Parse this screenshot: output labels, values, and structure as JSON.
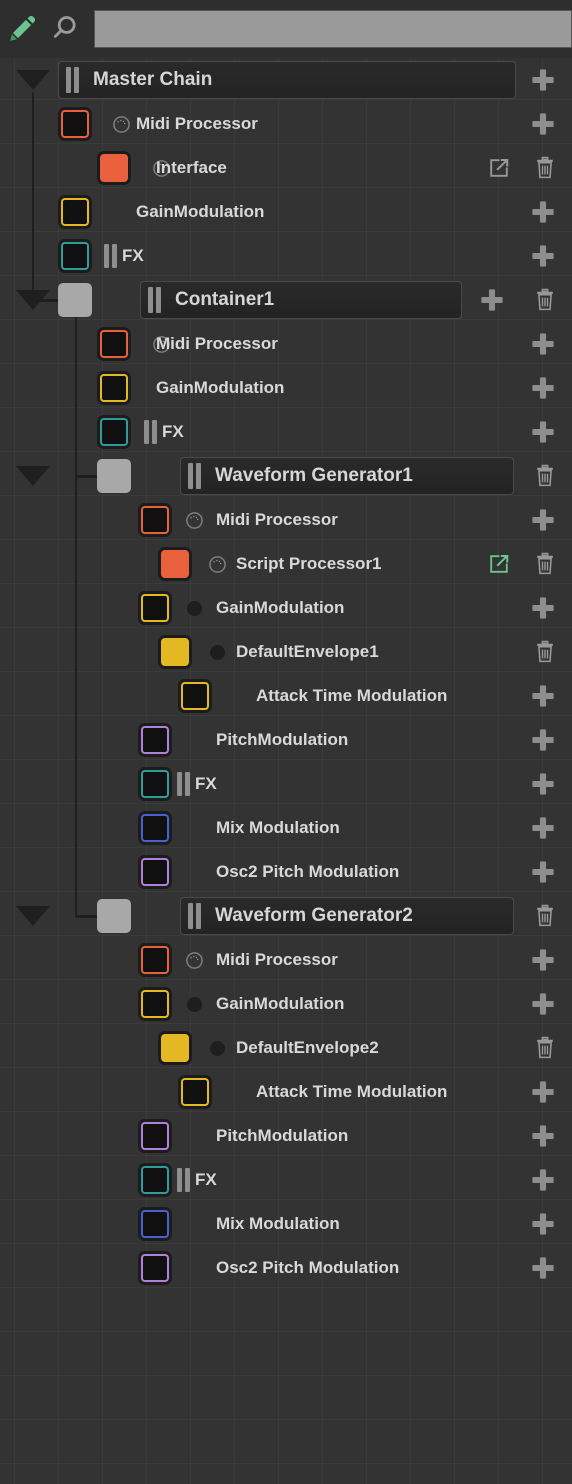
{
  "toolbar": {
    "pencil_icon": "pencil-icon",
    "search_icon": "search-icon",
    "search_value": "",
    "search_placeholder": "",
    "pencil_color": "#6cc48f"
  },
  "colors": {
    "background": "#333333",
    "toolbar_background": "#2e2e2e",
    "text": "#d9d9d9",
    "midi_processor": "#e8603c",
    "gain_modulation": "#e3b822",
    "fx": "#2f9b9b",
    "pitch_modulation": "#b07fe0",
    "mix_modulation": "#4a5fd0",
    "container": "#a8a8a8",
    "accent_green": "#6cc48f",
    "icon_gray": "#8e8e8e",
    "connector": "#1f1f1f"
  },
  "icons": {
    "add": "plus-icon",
    "delete": "trash-icon",
    "popout": "external-link-icon",
    "collapse": "triangle-down-icon",
    "drag": "drag-handle-icon",
    "knob": "knob-icon",
    "bullet": "dot-icon"
  },
  "tree": {
    "rows": [
      {
        "id": "master-chain",
        "label": "Master Chain",
        "kind": "chain",
        "depth": 0,
        "toggle": true,
        "swatch": null,
        "icon": "drag",
        "actions": [
          "add"
        ]
      },
      {
        "id": "midi-processor-master",
        "label": "Midi Processor",
        "kind": "module",
        "depth": 1,
        "toggle": false,
        "swatch": "midi_processor",
        "swatch_style": "outline",
        "icon": "knob",
        "actions": [
          "add"
        ]
      },
      {
        "id": "interface",
        "label": "Interface",
        "kind": "module",
        "depth": 2,
        "toggle": false,
        "swatch": "midi_processor",
        "swatch_style": "solid",
        "icon": "knob",
        "actions": [
          "popout",
          "delete"
        ]
      },
      {
        "id": "gainmodulation-master",
        "label": "GainModulation",
        "kind": "module",
        "depth": 1,
        "toggle": false,
        "swatch": "gain_modulation",
        "swatch_style": "outline",
        "icon": "none",
        "actions": [
          "add"
        ]
      },
      {
        "id": "fx-master",
        "label": "FX",
        "kind": "module",
        "depth": 1,
        "toggle": false,
        "swatch": "fx",
        "swatch_style": "outline",
        "icon": "bars",
        "actions": [
          "add"
        ]
      },
      {
        "id": "container1",
        "label": "Container1",
        "kind": "container",
        "depth": 1,
        "toggle": true,
        "swatch": "container",
        "swatch_style": "plain",
        "icon": "drag",
        "actions": [
          "add",
          "delete"
        ]
      },
      {
        "id": "midi-processor-c1",
        "label": "Midi Processor",
        "kind": "module",
        "depth": 2,
        "toggle": false,
        "swatch": "midi_processor",
        "swatch_style": "outline",
        "icon": "knob",
        "actions": [
          "add"
        ]
      },
      {
        "id": "gainmodulation-c1",
        "label": "GainModulation",
        "kind": "module",
        "depth": 2,
        "toggle": false,
        "swatch": "gain_modulation",
        "swatch_style": "outline",
        "icon": "none",
        "actions": [
          "add"
        ]
      },
      {
        "id": "fx-c1",
        "label": "FX",
        "kind": "module",
        "depth": 2,
        "toggle": false,
        "swatch": "fx",
        "swatch_style": "outline",
        "icon": "bars",
        "actions": [
          "add"
        ]
      },
      {
        "id": "waveform-generator1",
        "label": "Waveform Generator1",
        "kind": "container",
        "depth": 2,
        "toggle": true,
        "swatch": "container",
        "swatch_style": "plain",
        "icon": "drag",
        "actions": [
          "delete"
        ]
      },
      {
        "id": "midi-processor-wg1",
        "label": "Midi Processor",
        "kind": "module",
        "depth": 3,
        "toggle": false,
        "swatch": "midi_processor",
        "swatch_style": "outline",
        "icon": "knob",
        "actions": [
          "add"
        ]
      },
      {
        "id": "script-processor1",
        "label": "Script Processor1",
        "kind": "module",
        "depth": 4,
        "toggle": false,
        "swatch": "midi_processor",
        "swatch_style": "solid",
        "icon": "knob",
        "actions": [
          "popout-green",
          "delete"
        ]
      },
      {
        "id": "gainmodulation-wg1",
        "label": "GainModulation",
        "kind": "module",
        "depth": 3,
        "toggle": false,
        "swatch": "gain_modulation",
        "swatch_style": "outline",
        "icon": "bullet",
        "actions": [
          "add"
        ]
      },
      {
        "id": "defaultenvelope1",
        "label": "DefaultEnvelope1",
        "kind": "module",
        "depth": 4,
        "toggle": false,
        "swatch": "gain_modulation",
        "swatch_style": "solid",
        "icon": "bullet",
        "actions": [
          "delete"
        ]
      },
      {
        "id": "attack-time-modulation-1",
        "label": "Attack Time Modulation",
        "kind": "module",
        "depth": 5,
        "toggle": false,
        "swatch": "gain_modulation",
        "swatch_style": "outline",
        "icon": "none",
        "actions": [
          "add"
        ]
      },
      {
        "id": "pitchmodulation-wg1",
        "label": "PitchModulation",
        "kind": "module",
        "depth": 3,
        "toggle": false,
        "swatch": "pitch_modulation",
        "swatch_style": "outline",
        "icon": "none",
        "actions": [
          "add"
        ]
      },
      {
        "id": "fx-wg1",
        "label": "FX",
        "kind": "module",
        "depth": 3,
        "toggle": false,
        "swatch": "fx",
        "swatch_style": "outline",
        "icon": "bars",
        "actions": [
          "add"
        ]
      },
      {
        "id": "mix-modulation-wg1",
        "label": "Mix Modulation",
        "kind": "module",
        "depth": 3,
        "toggle": false,
        "swatch": "mix_modulation",
        "swatch_style": "outline",
        "icon": "none",
        "actions": [
          "add"
        ]
      },
      {
        "id": "osc2-pitch-modulation-wg1",
        "label": "Osc2 Pitch Modulation",
        "kind": "module",
        "depth": 3,
        "toggle": false,
        "swatch": "pitch_modulation",
        "swatch_style": "outline",
        "icon": "none",
        "actions": [
          "add"
        ]
      },
      {
        "id": "waveform-generator2",
        "label": "Waveform Generator2",
        "kind": "container",
        "depth": 2,
        "toggle": true,
        "swatch": "container",
        "swatch_style": "plain",
        "icon": "drag",
        "actions": [
          "delete"
        ]
      },
      {
        "id": "midi-processor-wg2",
        "label": "Midi Processor",
        "kind": "module",
        "depth": 3,
        "toggle": false,
        "swatch": "midi_processor",
        "swatch_style": "outline",
        "icon": "knob",
        "actions": [
          "add"
        ]
      },
      {
        "id": "gainmodulation-wg2",
        "label": "GainModulation",
        "kind": "module",
        "depth": 3,
        "toggle": false,
        "swatch": "gain_modulation",
        "swatch_style": "outline",
        "icon": "bullet",
        "actions": [
          "add"
        ]
      },
      {
        "id": "defaultenvelope2",
        "label": "DefaultEnvelope2",
        "kind": "module",
        "depth": 4,
        "toggle": false,
        "swatch": "gain_modulation",
        "swatch_style": "solid",
        "icon": "bullet",
        "actions": [
          "delete"
        ]
      },
      {
        "id": "attack-time-modulation-2",
        "label": "Attack Time Modulation",
        "kind": "module",
        "depth": 5,
        "toggle": false,
        "swatch": "gain_modulation",
        "swatch_style": "outline",
        "icon": "none",
        "actions": [
          "add"
        ]
      },
      {
        "id": "pitchmodulation-wg2",
        "label": "PitchModulation",
        "kind": "module",
        "depth": 3,
        "toggle": false,
        "swatch": "pitch_modulation",
        "swatch_style": "outline",
        "icon": "none",
        "actions": [
          "add"
        ]
      },
      {
        "id": "fx-wg2",
        "label": "FX",
        "kind": "module",
        "depth": 3,
        "toggle": false,
        "swatch": "fx",
        "swatch_style": "outline",
        "icon": "bars",
        "actions": [
          "add"
        ]
      },
      {
        "id": "mix-modulation-wg2",
        "label": "Mix Modulation",
        "kind": "module",
        "depth": 3,
        "toggle": false,
        "swatch": "mix_modulation",
        "swatch_style": "outline",
        "icon": "none",
        "actions": [
          "add"
        ]
      },
      {
        "id": "osc2-pitch-modulation-wg2",
        "label": "Osc2 Pitch Modulation",
        "kind": "module",
        "depth": 3,
        "toggle": false,
        "swatch": "pitch_modulation",
        "swatch_style": "outline",
        "icon": "none",
        "actions": [
          "add"
        ]
      }
    ]
  }
}
